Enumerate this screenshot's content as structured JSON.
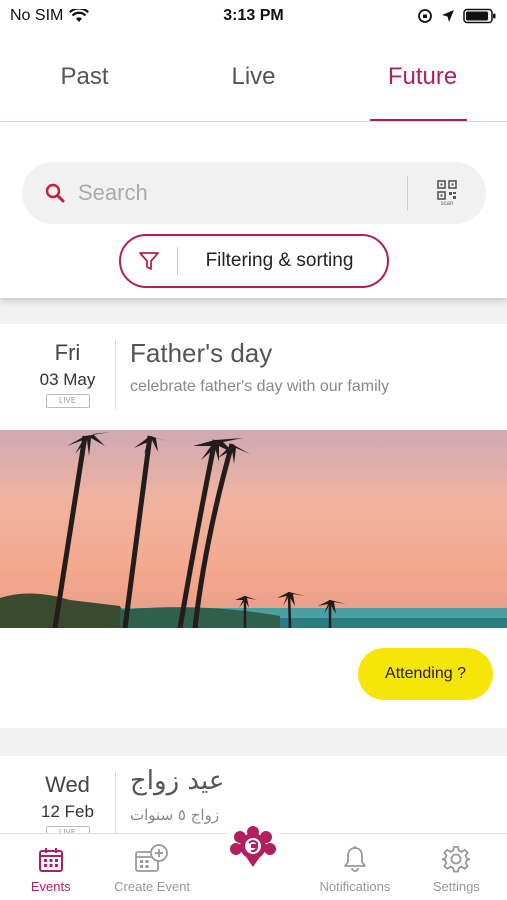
{
  "status_bar": {
    "carrier": "No SIM",
    "time": "3:13 PM"
  },
  "tabs": [
    {
      "label": "Past"
    },
    {
      "label": "Live"
    },
    {
      "label": "Future"
    }
  ],
  "search": {
    "placeholder": "Search",
    "scan_label": "scan"
  },
  "filter": {
    "label": "Filtering & sorting"
  },
  "events": [
    {
      "day": "Fri",
      "date": "03 May",
      "tag": "LIVE",
      "title": "Father's day",
      "description": "celebrate father's day with our family",
      "action_label": "Attending ?"
    },
    {
      "day": "Wed",
      "date": "12 Feb",
      "tag": "LIVE",
      "title": "عيد زواج",
      "description": "زواج ٥ سنوات"
    }
  ],
  "bottom_nav": [
    {
      "label": "Events",
      "icon": "calendar-icon"
    },
    {
      "label": "Create Event",
      "icon": "calendar-add-icon"
    },
    {
      "label": "",
      "icon": "app-logo-icon"
    },
    {
      "label": "Notifications",
      "icon": "bell-icon"
    },
    {
      "label": "Settings",
      "icon": "gear-icon"
    }
  ],
  "colors": {
    "accent": "#b0205f",
    "attend_button": "#f6e509"
  }
}
